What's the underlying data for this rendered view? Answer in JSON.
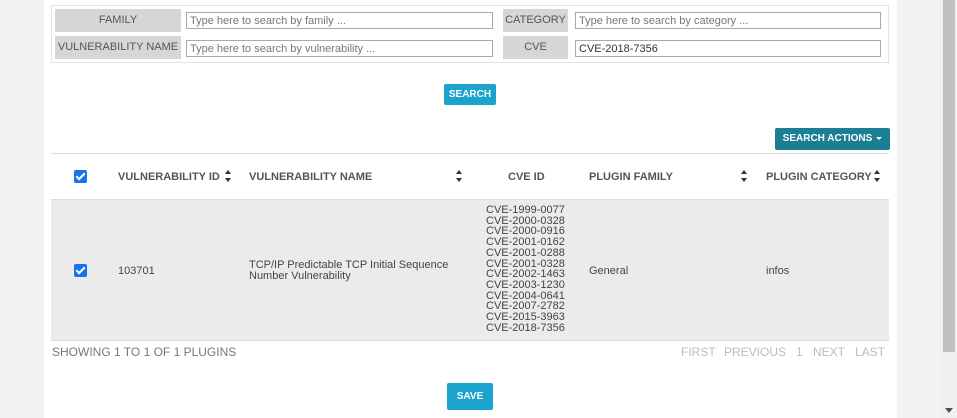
{
  "filters": {
    "family_label": "FAMILY",
    "family_placeholder": "Type here to search by family ...",
    "category_label": "CATEGORY",
    "category_placeholder": "Type here to search by category ...",
    "vuln_name_label": "VULNERABILITY NAME",
    "vuln_name_placeholder": "Type here to search by vulnerability ...",
    "cve_label": "CVE",
    "cve_value": "CVE-2018-7356"
  },
  "search_button": "SEARCH",
  "search_actions_button": "SEARCH ACTIONS",
  "table": {
    "headers": {
      "vuln_id": "VULNERABILITY ID",
      "vuln_name": "VULNERABILITY NAME",
      "cve_id": "CVE ID",
      "plugin_family": "PLUGIN FAMILY",
      "plugin_category": "PLUGIN CATEGORY"
    },
    "rows": [
      {
        "checked": true,
        "vuln_id": "103701",
        "vuln_name_line1": "TCP/IP Predictable TCP Initial Sequence",
        "vuln_name_line2": "Number Vulnerability",
        "cve_ids": [
          "CVE-1999-0077",
          "CVE-2000-0328",
          "CVE-2000-0916",
          "CVE-2001-0162",
          "CVE-2001-0288",
          "CVE-2001-0328",
          "CVE-2002-1463",
          "CVE-2003-1230",
          "CVE-2004-0641",
          "CVE-2007-2782",
          "CVE-2015-3963",
          "CVE-2018-7356"
        ],
        "plugin_family": "General",
        "plugin_category": "infos"
      }
    ]
  },
  "footer": {
    "showing": "SHOWING 1 TO 1 OF 1 PLUGINS",
    "first": "FIRST",
    "previous": "PREVIOUS",
    "page": "1",
    "next": "NEXT",
    "last": "LAST"
  },
  "save_button": "SAVE",
  "colors": {
    "primary": "#1aa3cc",
    "dark_primary": "#1a7f93",
    "checkbox": "#1a73e8",
    "row_bg": "#ebebeb",
    "label_bg": "#d6d6d6"
  }
}
